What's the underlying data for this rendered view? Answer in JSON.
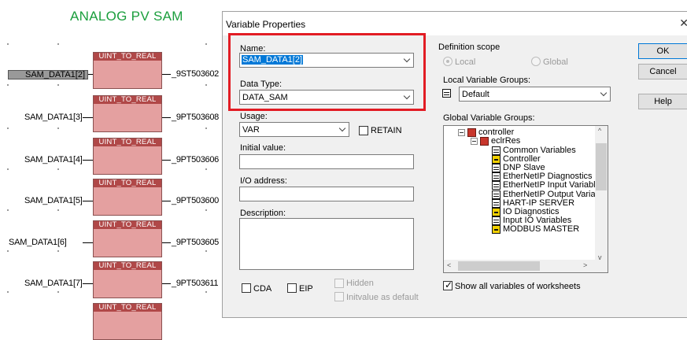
{
  "diagram": {
    "title": "ANALOG PV SAM",
    "blocks": [
      {
        "header": "UINT_TO_REAL",
        "input": "SAM_DATA1[2]",
        "output": "_9ST503602"
      },
      {
        "header": "UINT_TO_REAL",
        "input": "SAM_DATA1[3]",
        "output": "_9PT503608"
      },
      {
        "header": "UINT_TO_REAL",
        "input": "SAM_DATA1[4]",
        "output": "_9PT503606"
      },
      {
        "header": "UINT_TO_REAL",
        "input": "SAM_DATA1[5]",
        "output": "_9PT503600"
      },
      {
        "header": "UINT_TO_REAL",
        "input": "SAM_DATA1[6]",
        "output": "_9PT503605"
      },
      {
        "header": "UINT_TO_REAL",
        "input": "SAM_DATA1[7]",
        "output": "_9PT503611"
      },
      {
        "header": "UINT_TO_REAL"
      }
    ]
  },
  "dialog": {
    "title": "Variable Properties",
    "name_label": "Name:",
    "name_value": "SAM_DATA1[2]",
    "datatype_label": "Data Type:",
    "datatype_value": "DATA_SAM",
    "usage_label": "Usage:",
    "usage_value": "VAR",
    "retain_label": "RETAIN",
    "initial_label": "Initial value:",
    "initial_value": "",
    "io_label": "I/O address:",
    "io_value": "",
    "description_label": "Description:",
    "description_value": "",
    "cda_label": "CDA",
    "eip_label": "EIP",
    "hidden_label": "Hidden",
    "initvalue_default_label": "Initvalue as default",
    "scope_label": "Definition scope",
    "scope_local": "Local",
    "scope_global": "Global",
    "local_groups_label": "Local Variable Groups:",
    "local_groups_value": "Default",
    "global_groups_label": "Global Variable Groups:",
    "show_all_label": "Show all variables of worksheets",
    "ok_label": "OK",
    "cancel_label": "Cancel",
    "help_label": "Help",
    "tree": {
      "controller": "controller",
      "res": "eclrRes",
      "items": [
        {
          "label": "Common Variables",
          "icon": "var-group-icon"
        },
        {
          "label": "Controller",
          "icon": "yellow-group-icon"
        },
        {
          "label": "DNP Slave",
          "icon": "var-group-icon"
        },
        {
          "label": "EtherNetIP Diagnostics",
          "icon": "var-group-icon"
        },
        {
          "label": "EtherNetIP Input Variabl",
          "icon": "var-group-icon"
        },
        {
          "label": "EtherNetIP Output Varial",
          "icon": "var-group-icon"
        },
        {
          "label": "HART-IP SERVER",
          "icon": "var-group-icon"
        },
        {
          "label": "IO Diagnostics",
          "icon": "yellow-group-icon"
        },
        {
          "label": "Input IO Variables",
          "icon": "var-group-icon"
        },
        {
          "label": "MODBUS MASTER",
          "icon": "yellow-group-icon"
        }
      ]
    }
  }
}
